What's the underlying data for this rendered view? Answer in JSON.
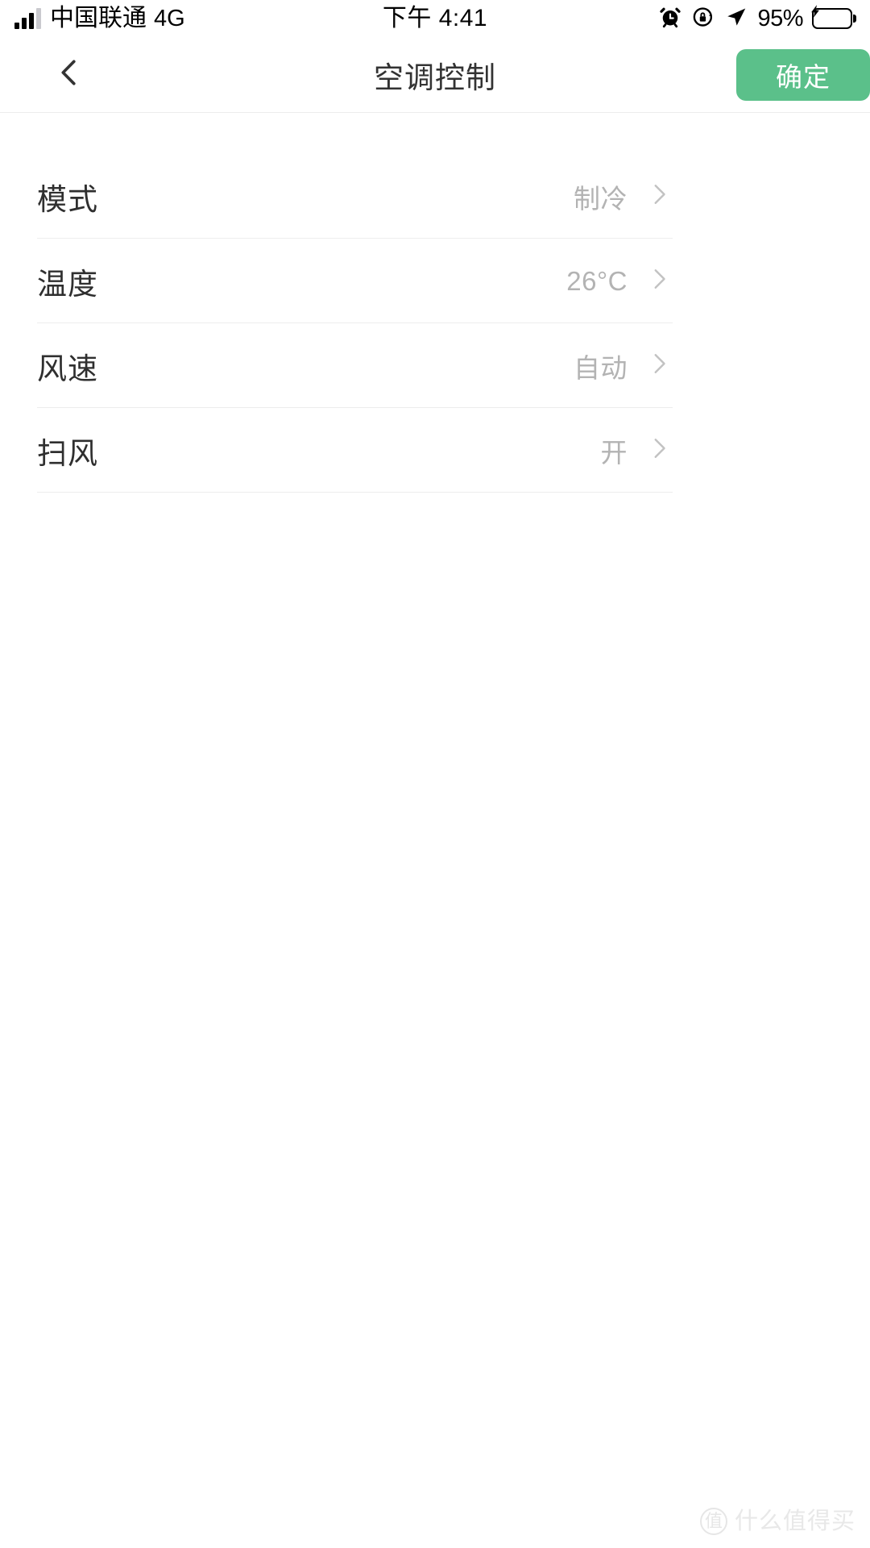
{
  "status_bar": {
    "carrier": "中国联通",
    "network": "4G",
    "time": "下午 4:41",
    "battery_percent": "95%",
    "signal_bars_filled": 3,
    "signal_bars_total": 4,
    "icons": [
      "alarm-clock-icon",
      "rotation-lock-icon",
      "location-arrow-icon",
      "battery-charging-icon"
    ]
  },
  "header": {
    "back_label": "‹",
    "title": "空调控制",
    "confirm_label": "确定",
    "confirm_color": "#5BC08A"
  },
  "settings": {
    "rows": [
      {
        "label": "模式",
        "value": "制冷"
      },
      {
        "label": "温度",
        "value": "26°C"
      },
      {
        "label": "风速",
        "value": "自动"
      },
      {
        "label": "扫风",
        "value": "开"
      }
    ]
  },
  "watermark": {
    "badge": "值",
    "text": "什么值得买"
  }
}
